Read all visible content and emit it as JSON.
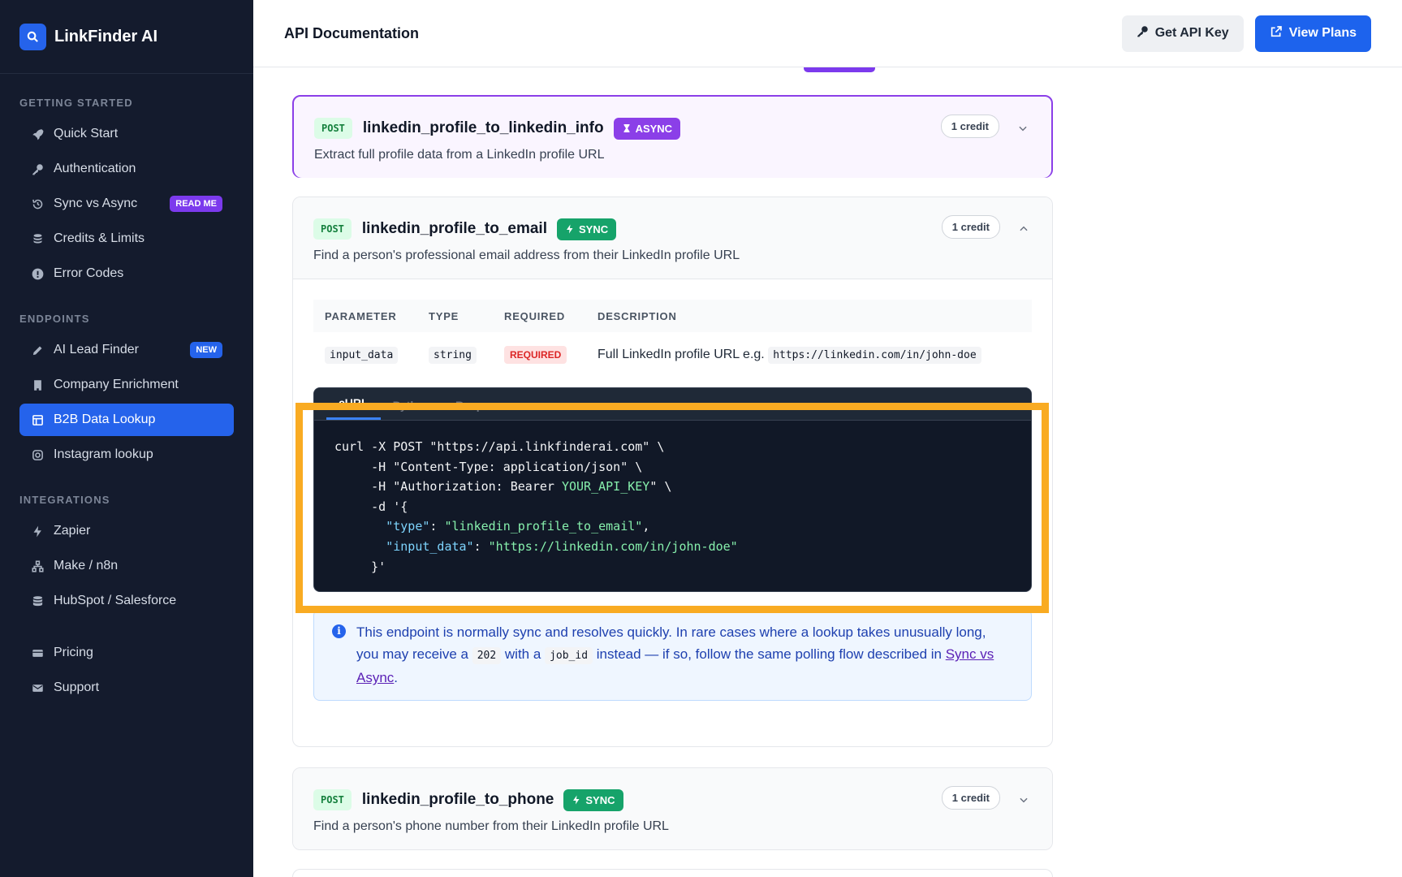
{
  "brand": {
    "name": "LinkFinder AI",
    "logo_icon": "search-icon"
  },
  "sidebar": {
    "sections": [
      {
        "heading": "GETTING STARTED",
        "items": [
          {
            "label": "Quick Start",
            "icon": "rocket-icon"
          },
          {
            "label": "Authentication",
            "icon": "key-icon"
          },
          {
            "label": "Sync vs Async",
            "icon": "history-icon",
            "badge": "READ ME"
          },
          {
            "label": "Credits & Limits",
            "icon": "coins-icon"
          },
          {
            "label": "Error Codes",
            "icon": "alert-icon"
          }
        ]
      },
      {
        "heading": "ENDPOINTS",
        "items": [
          {
            "label": "AI Lead Finder",
            "icon": "pen-icon",
            "badge": "NEW"
          },
          {
            "label": "Company Enrichment",
            "icon": "building-icon"
          },
          {
            "label": "B2B Data Lookup",
            "icon": "table-icon",
            "active": true
          },
          {
            "label": "Instagram lookup",
            "icon": "instagram-icon"
          }
        ]
      },
      {
        "heading": "INTEGRATIONS",
        "items": [
          {
            "label": "Zapier",
            "icon": "bolt-icon"
          },
          {
            "label": "Make / n8n",
            "icon": "network-icon"
          },
          {
            "label": "HubSpot / Salesforce",
            "icon": "database-icon"
          }
        ]
      },
      {
        "heading": "",
        "items": [
          {
            "label": "Pricing",
            "icon": "card-icon"
          },
          {
            "label": "Support",
            "icon": "mail-icon"
          }
        ]
      }
    ]
  },
  "header": {
    "title": "API Documentation",
    "get_key_label": "Get API Key",
    "view_plans_label": "View Plans"
  },
  "endpoints": [
    {
      "method": "POST",
      "name": "linkedin_profile_to_linkedin_info",
      "mode": "ASYNC",
      "credit": "1 credit",
      "description": "Extract full profile data from a LinkedIn profile URL",
      "expanded": false
    },
    {
      "method": "POST",
      "name": "linkedin_profile_to_email",
      "mode": "SYNC",
      "credit": "1 credit",
      "description": "Find a person's professional email address from their LinkedIn profile URL",
      "expanded": true,
      "params_header": {
        "parameter": "PARAMETER",
        "type": "TYPE",
        "required": "REQUIRED",
        "description": "DESCRIPTION"
      },
      "params": [
        {
          "name": "input_data",
          "type": "string",
          "required": "REQUIRED",
          "description": "Full LinkedIn profile URL e.g.",
          "example": "https://linkedin.com/in/john-doe"
        }
      ],
      "code_tabs": [
        "cURL",
        "Python",
        "Response"
      ],
      "code": {
        "line1": "curl -X POST \"https://api.linkfinderai.com\" \\",
        "line2": "     -H \"Content-Type: application/json\" \\",
        "line3_pre": "     -H \"Authorization: Bearer ",
        "line3_key": "YOUR_API_KEY",
        "line3_post": "\" \\",
        "line4": "     -d '{",
        "line5_key": "\"type\"",
        "line5_val": "\"linkedin_profile_to_email\"",
        "line6_key": "\"input_data\"",
        "line6_val": "\"https://linkedin.com/in/john-doe\"",
        "line7": "     }'"
      },
      "note": {
        "part1": "This endpoint is normally sync and resolves quickly. In rare cases where a lookup takes unusually long, you may receive a",
        "code1": "202",
        "part2": "with a",
        "code2": "job_id",
        "part3": "instead — if so, follow the same polling flow described in",
        "link": "Sync vs Async",
        "part4": "."
      }
    },
    {
      "method": "POST",
      "name": "linkedin_profile_to_phone",
      "mode": "SYNC",
      "credit": "1 credit",
      "description": "Find a person's phone number from their LinkedIn profile URL",
      "expanded": false
    }
  ],
  "colors": {
    "accent": "#2563eb",
    "async": "#8b3fe8",
    "sync": "#16a36a",
    "highlight": "#f9ab22"
  }
}
